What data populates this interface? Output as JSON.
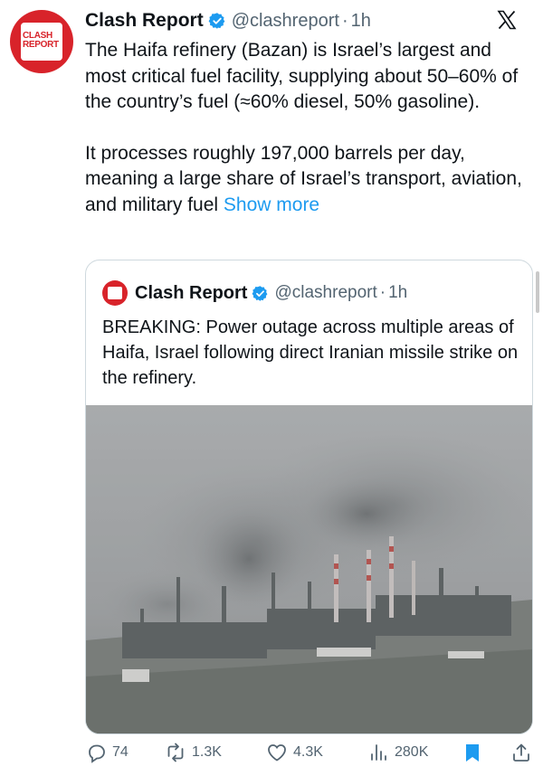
{
  "tweet": {
    "author_name": "Clash Report",
    "handle": "@clashreport",
    "separator": "·",
    "time": "1h",
    "avatar_text_1": "CLASH",
    "avatar_text_2": "REPORT",
    "paragraph_1": "The Haifa refinery (Bazan) is Israel’s largest and most critical fuel facility, supplying about 50–60% of the country’s fuel (≈60% diesel, 50% gasoline).",
    "paragraph_2": "It processes roughly 197,000 barrels per day, meaning a large share of Israel’s transport, aviation, and military fuel",
    "show_more": "Show more"
  },
  "quoted_tweet": {
    "author_name": "Clash Report",
    "handle": "@clashreport",
    "separator": "·",
    "time": "1h",
    "text": "BREAKING: Power outage across multiple areas of Haifa, Israel following direct Iranian missile strike on the refinery."
  },
  "actions": {
    "replies": "74",
    "reposts": "1.3K",
    "likes": "4.3K",
    "views": "280K"
  },
  "colors": {
    "brand_red": "#d8232a",
    "link_blue": "#1d9bf0",
    "verified_blue": "#1d9bf0",
    "muted_text": "#536471"
  },
  "icons": [
    "verified-badge-icon",
    "x-logo-icon",
    "reply-icon",
    "repost-icon",
    "like-icon",
    "views-icon",
    "bookmark-icon",
    "share-icon"
  ]
}
